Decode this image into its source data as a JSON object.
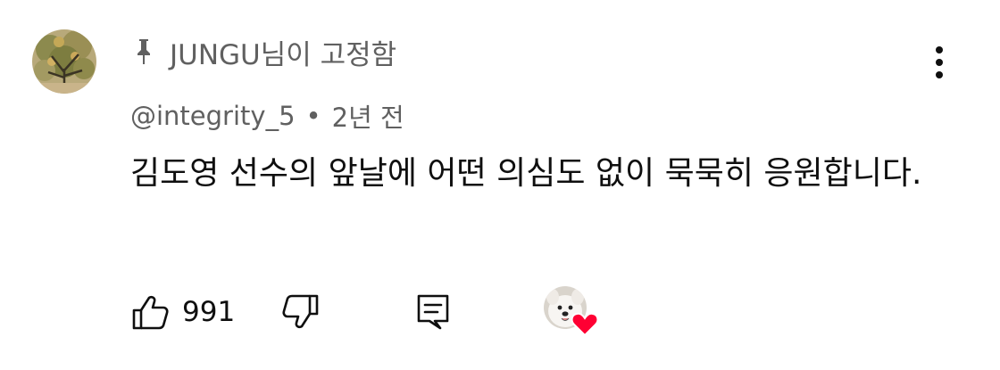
{
  "pinned": {
    "text": "JUNGU님이 고정함",
    "icon": "pin-icon"
  },
  "comment": {
    "author": "@integrity_5",
    "separator": "•",
    "time": "2년 전",
    "text": "김도영 선수의 앞날에 어떤 의심도 없이 묵묵히 응원합니다."
  },
  "actions": {
    "like_count": "991",
    "like_icon": "thumbs-up-icon",
    "dislike_icon": "thumbs-down-icon",
    "reply_icon": "reply-icon",
    "hearted_icon": "heart-icon"
  },
  "colors": {
    "text_primary": "#0f0f0f",
    "text_secondary": "#606060",
    "heart": "#ff0033"
  }
}
